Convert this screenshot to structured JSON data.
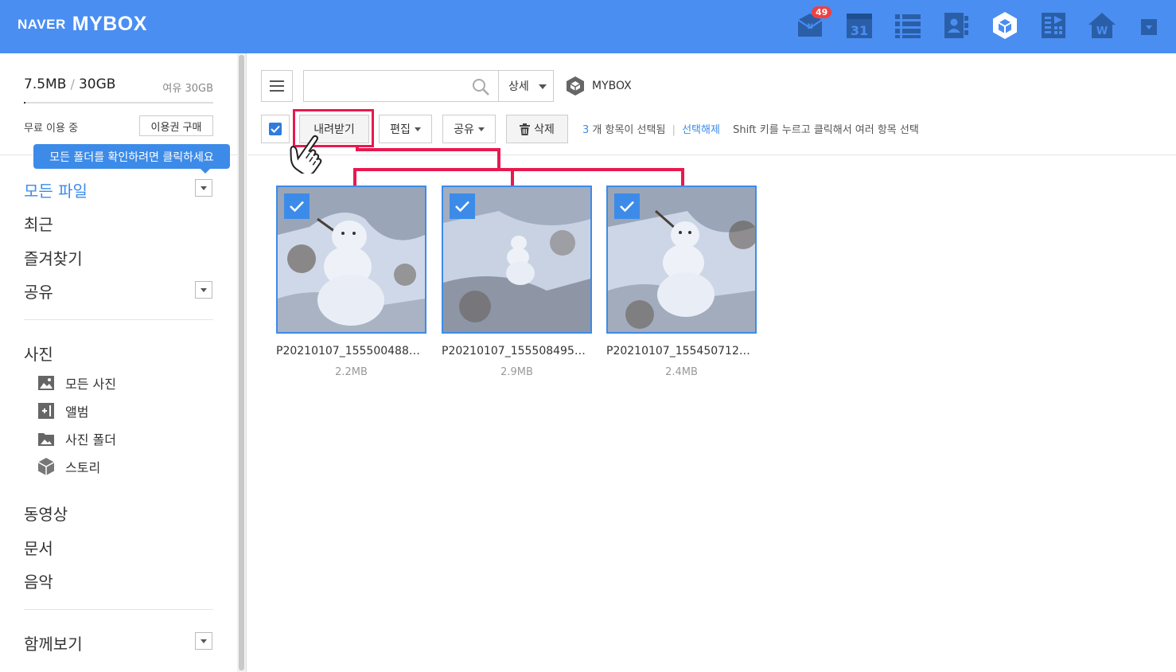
{
  "header": {
    "logo_naver": "NAVER",
    "logo_mybox": "MYBOX",
    "mail_badge": "49",
    "calendar_day": "31",
    "apps": [
      "mail-icon",
      "calendar-icon",
      "memo-icon",
      "contacts-icon",
      "mybox-icon",
      "office-icon",
      "home-icon",
      "more-menu-icon"
    ],
    "accent": "#4a8ef2"
  },
  "sidebar": {
    "used": "7.5MB",
    "separator": "/",
    "total": "30GB",
    "free": "여유 30GB",
    "usage_fraction": 0.00025,
    "plan_label": "무료 이용 중",
    "plan_button": "이용권 구매",
    "tooltip": "모든 폴더를 확인하려면 클릭하세요",
    "nav": {
      "all_files": "모든 파일",
      "recent": "최근",
      "favorites": "즐겨찾기",
      "shared": "공유",
      "photos": "사진",
      "photo_items": [
        "모든 사진",
        "앨범",
        "사진 폴더",
        "스토리"
      ],
      "videos": "동영상",
      "documents": "문서",
      "music": "음악",
      "together": "함께보기"
    }
  },
  "toolbar": {
    "search_placeholder": "",
    "detail": "상세",
    "location": "MYBOX",
    "download": "내려받기",
    "edit": "편집",
    "share": "공유",
    "delete": "삭제",
    "selected_count": "3",
    "selected_text": "개 항목이 선택됨",
    "separator": "|",
    "deselect": "선택해제",
    "hint": "Shift 키를 누르고 클릭해서 여러 항목 선택",
    "highlight_color": "#e8194f"
  },
  "files": [
    {
      "name": "P20210107_155500488…",
      "size": "2.2MB",
      "selected": true
    },
    {
      "name": "P20210107_155508495…",
      "size": "2.9MB",
      "selected": true
    },
    {
      "name": "P20210107_155450712…",
      "size": "2.4MB",
      "selected": true
    }
  ]
}
